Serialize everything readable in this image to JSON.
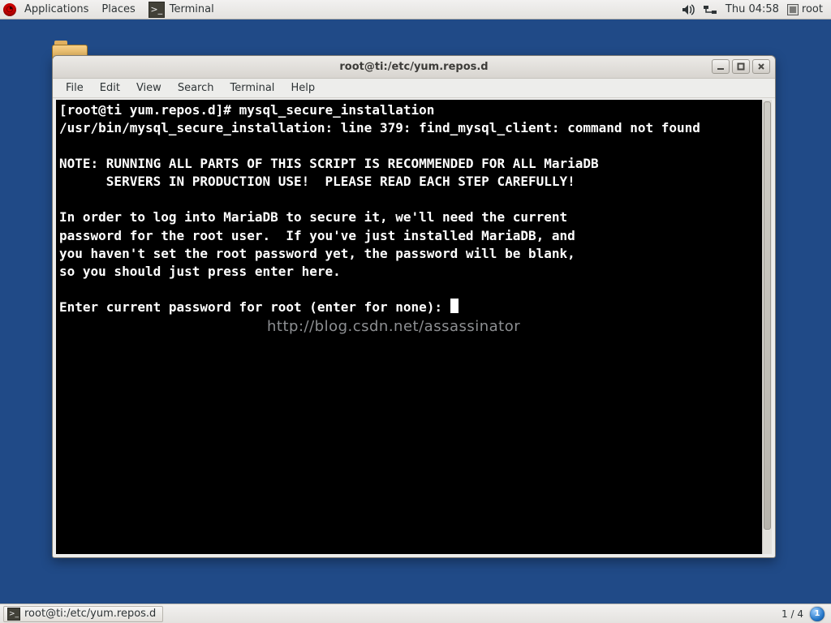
{
  "panel": {
    "applications_label": "Applications",
    "places_label": "Places",
    "task_title": "Terminal",
    "clock": "Thu 04:58",
    "user": "root"
  },
  "window": {
    "title": "root@ti:/etc/yum.repos.d",
    "menu": {
      "file": "File",
      "edit": "Edit",
      "view": "View",
      "search": "Search",
      "terminal": "Terminal",
      "help": "Help"
    }
  },
  "terminal": {
    "prompt": "[root@ti yum.repos.d]# ",
    "command": "mysql_secure_installation",
    "out_err": "/usr/bin/mysql_secure_installation: line 379: find_mysql_client: command not found",
    "note1": "NOTE: RUNNING ALL PARTS OF THIS SCRIPT IS RECOMMENDED FOR ALL MariaDB",
    "note2": "      SERVERS IN PRODUCTION USE!  PLEASE READ EACH STEP CAREFULLY!",
    "para1": "In order to log into MariaDB to secure it, we'll need the current",
    "para2": "password for the root user.  If you've just installed MariaDB, and",
    "para3": "you haven't set the root password yet, the password will be blank,",
    "para4": "so you should just press enter here.",
    "prompt2": "Enter current password for root (enter for none): ",
    "watermark": "http://blog.csdn.net/assassinator"
  },
  "taskbar": {
    "task_label": "root@ti:/etc/yum.repos.d",
    "workspace": "1 / 4",
    "badge": "1"
  }
}
